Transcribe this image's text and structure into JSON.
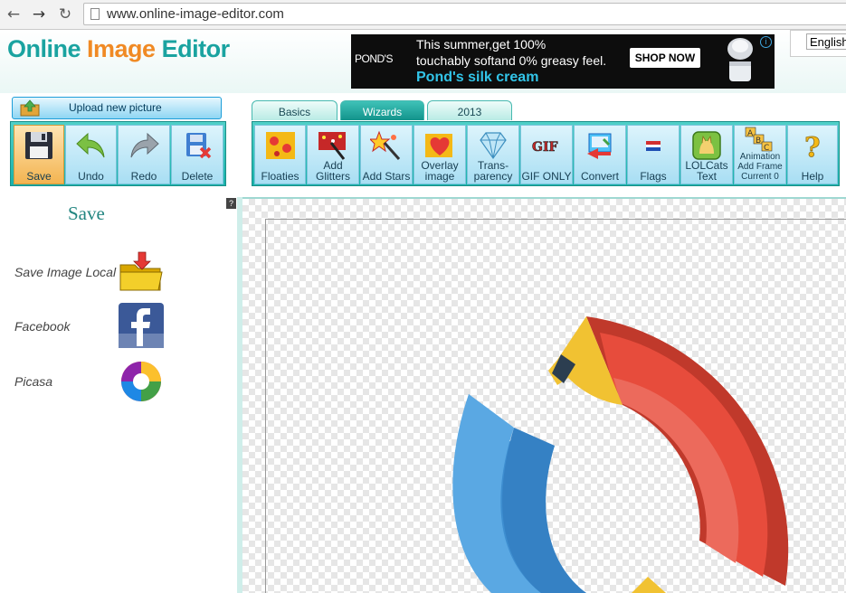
{
  "browser": {
    "url": "www.online-image-editor.com"
  },
  "header": {
    "logo_word1": "Online",
    "logo_word2": "Image",
    "logo_word3": "Editor",
    "language": "English"
  },
  "ad": {
    "brand": "POND'S",
    "line1": "This summer,get 100%",
    "line2": "touchably softand 0% greasy feel.",
    "line3": "Pond's silk cream",
    "cta": "SHOP NOW"
  },
  "upload": {
    "label": "Upload new picture"
  },
  "tabs": [
    {
      "label": "Basics"
    },
    {
      "label": "Wizards"
    },
    {
      "label": "2013"
    }
  ],
  "left_tools": [
    {
      "label": "Save",
      "icon": "floppy-icon"
    },
    {
      "label": "Undo",
      "icon": "undo-arrow-icon"
    },
    {
      "label": "Redo",
      "icon": "redo-arrow-icon"
    },
    {
      "label": "Delete",
      "icon": "delete-icon"
    }
  ],
  "right_tools": [
    {
      "label": "Floaties"
    },
    {
      "label": "Add Glitters"
    },
    {
      "label": "Add Stars"
    },
    {
      "label": "Overlay image"
    },
    {
      "label": "Trans-parency"
    },
    {
      "label": "GIF ONLY"
    },
    {
      "label": "Convert"
    },
    {
      "label": "Flags"
    },
    {
      "label": "LOLCats Text"
    },
    {
      "label": "Animation",
      "sub1": "Add Frame",
      "sub2": "Current 0"
    },
    {
      "label": "Help"
    }
  ],
  "panel": {
    "title": "Save",
    "help": "?",
    "options": [
      {
        "label": "Save Image Local"
      },
      {
        "label": "Facebook"
      },
      {
        "label": "Picasa"
      }
    ]
  },
  "colors": {
    "teal": "#1aa3a0",
    "orange": "#f08a24",
    "toolbar": "#26b8b0",
    "ring_red": "#e84c3d",
    "ring_blue": "#3f95d3",
    "ring_yellow": "#f1c232"
  }
}
